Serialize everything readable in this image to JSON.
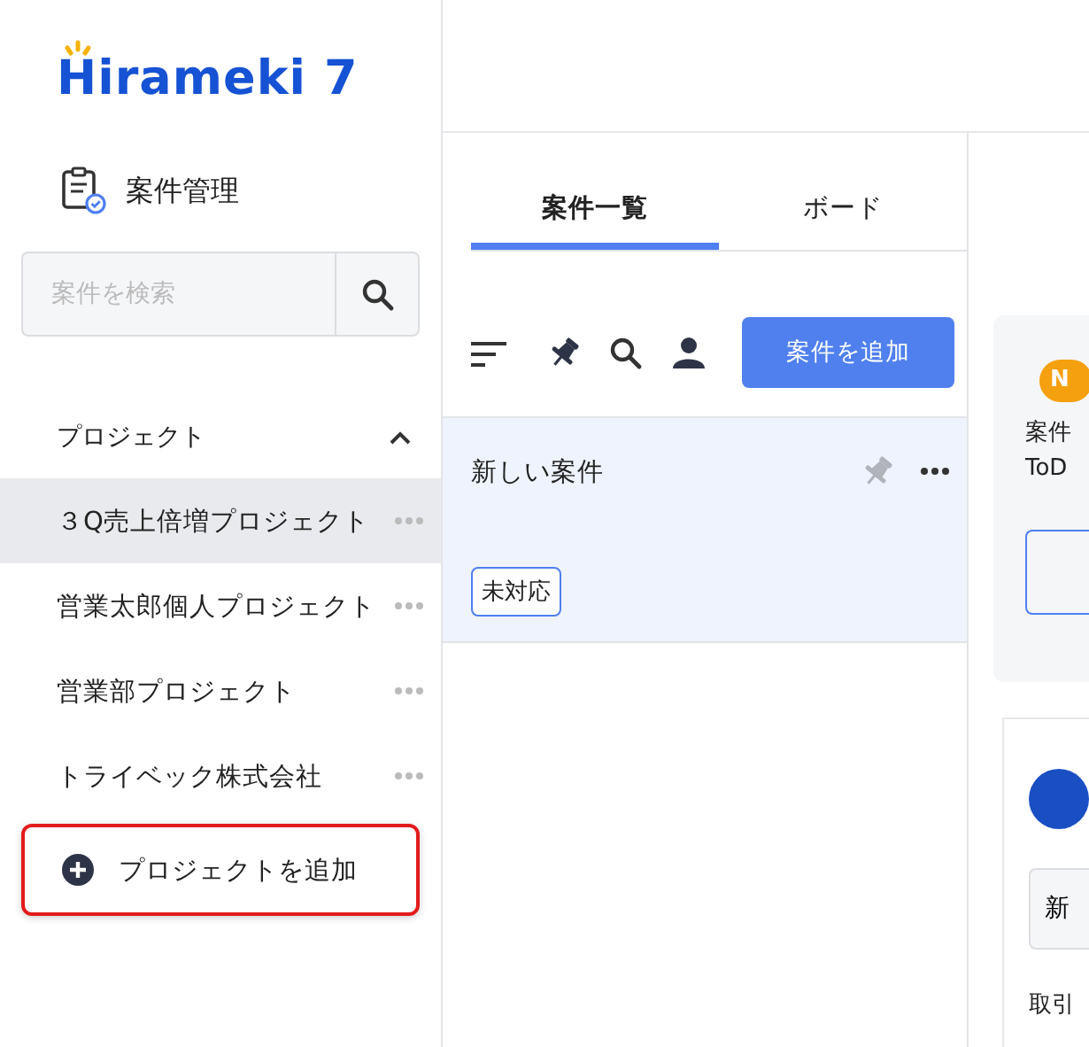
{
  "logo": {
    "text": "Hirameki 7"
  },
  "sidebar": {
    "section_title": "案件管理",
    "search": {
      "placeholder": "案件を検索"
    },
    "projects_header": {
      "label": "プロジェクト",
      "expanded": true
    },
    "projects": [
      {
        "label": "３Q売上倍増プロジェクト",
        "selected": true
      },
      {
        "label": "営業太郎個人プロジェクト",
        "selected": false
      },
      {
        "label": "営業部プロジェクト",
        "selected": false
      },
      {
        "label": "トライベック株式会社",
        "selected": false
      }
    ],
    "add_project": {
      "label": "プロジェクトを追加",
      "highlighted": true
    }
  },
  "tabs": [
    {
      "label": "案件一覧",
      "selected": true
    },
    {
      "label": "ボード",
      "selected": false
    }
  ],
  "add_case_button": "案件を追加",
  "cases": [
    {
      "title": "新しい案件",
      "status": "未対応",
      "selected": true
    }
  ],
  "right_panel": {
    "badge": "N",
    "lines": [
      "案件",
      "ToD"
    ],
    "card_button": "新",
    "footer_text": "取引"
  }
}
